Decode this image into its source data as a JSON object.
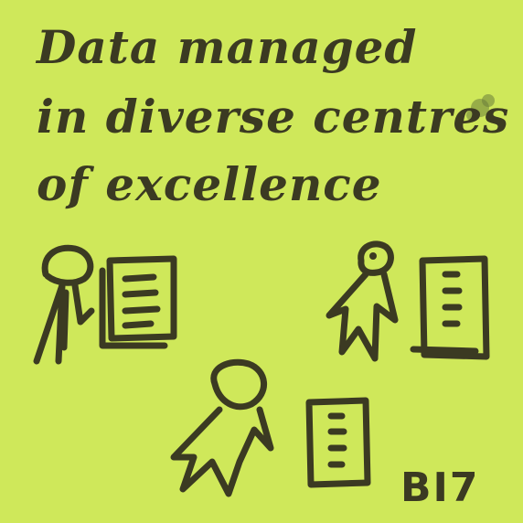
{
  "note": {
    "line1": "Data managed",
    "line2": "in diverse centres",
    "line3": "of excellence",
    "tag": "BI7"
  }
}
